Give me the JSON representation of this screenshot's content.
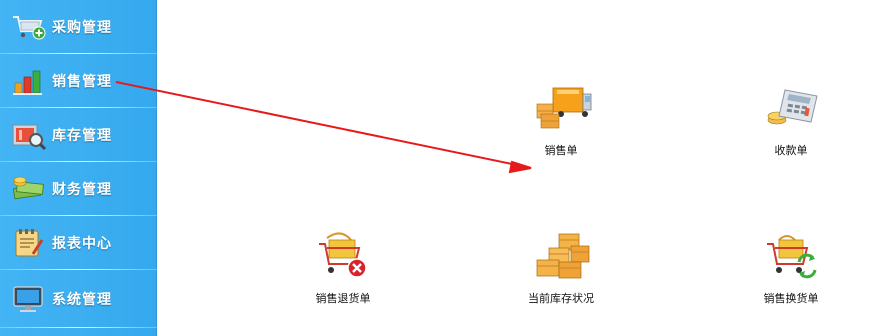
{
  "sidebar": {
    "items": [
      {
        "label": "采购管理",
        "icon": "shopping-cart-add-icon"
      },
      {
        "label": "销售管理",
        "icon": "bar-chart-icon"
      },
      {
        "label": "库存管理",
        "icon": "inventory-search-icon"
      },
      {
        "label": "财务管理",
        "icon": "money-stack-icon"
      },
      {
        "label": "报表中心",
        "icon": "notepad-report-icon"
      },
      {
        "label": "系统管理",
        "icon": "monitor-icon"
      }
    ]
  },
  "main": {
    "tiles": [
      {
        "label": "销售单",
        "icon": "delivery-truck-icon"
      },
      {
        "label": "收款单",
        "icon": "calculator-icon"
      },
      {
        "label": "销售退货单",
        "icon": "cart-return-icon"
      },
      {
        "label": "当前库存状况",
        "icon": "stacked-boxes-icon"
      },
      {
        "label": "销售换货单",
        "icon": "cart-exchange-icon"
      }
    ]
  },
  "colors": {
    "sidebar_bg": "#3aaef1",
    "arrow": "#e8191b",
    "caption_text": "#111111"
  }
}
